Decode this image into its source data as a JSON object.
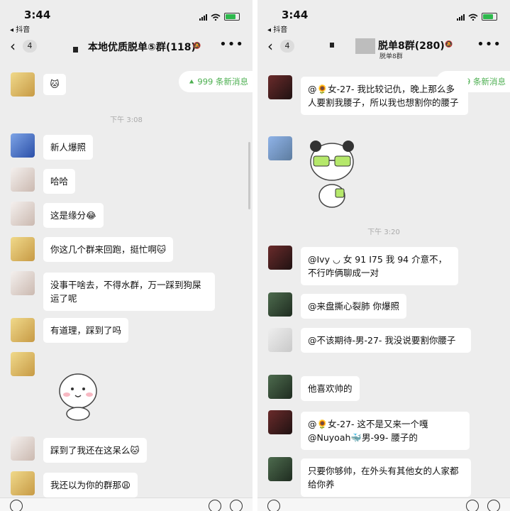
{
  "left": {
    "status_time": "3:44",
    "back_app": "◂ 抖音",
    "back_count": "4",
    "title": "本地优质脱单⑤群(118)",
    "new_msgs": "999 条新消息",
    "sys_time": "下午 3:08",
    "messages": [
      {
        "text": "新人爆照"
      },
      {
        "text": "哈哈"
      },
      {
        "text": "这是缘分😂"
      },
      {
        "text": "你这几个群来回跑，挺忙啊🐱"
      },
      {
        "text": "没事干啥去，不得水群，万一踩到狗屎运了呢"
      },
      {
        "text": "有道理，踩到了吗"
      },
      {
        "text": "踩到了我还在这呆么🐱"
      },
      {
        "text": "我还以为你的群那😩"
      }
    ]
  },
  "right": {
    "status_time": "3:44",
    "back_app": "◂ 抖音",
    "back_count": "4",
    "title": "脱单8群(280)",
    "subtitle": "脱单8群",
    "new_msgs": "999 条新消息",
    "sys_time": "下午 3:20",
    "messages": [
      {
        "text": "@🌻女-27-  我比较记仇，晚上那么多人要割我腰子，所以我也想割你的腰子"
      },
      {
        "text": "@Ivy ◡ 女 91    I75 我 94 介意不，不行咋俩聊成一对"
      },
      {
        "text": "@来盘撕心裂肺 你爆照"
      },
      {
        "text": "@不该期待-男-27-    我没说要割你腰子"
      },
      {
        "text": "他喜欢帅的"
      },
      {
        "text": "@🌻女-27-    这不是又来一个嘎 @Nuyoah🐳男-99-    腰子的"
      },
      {
        "text": "只要你够帅，在外头有其他女的人家都给你养"
      }
    ]
  }
}
